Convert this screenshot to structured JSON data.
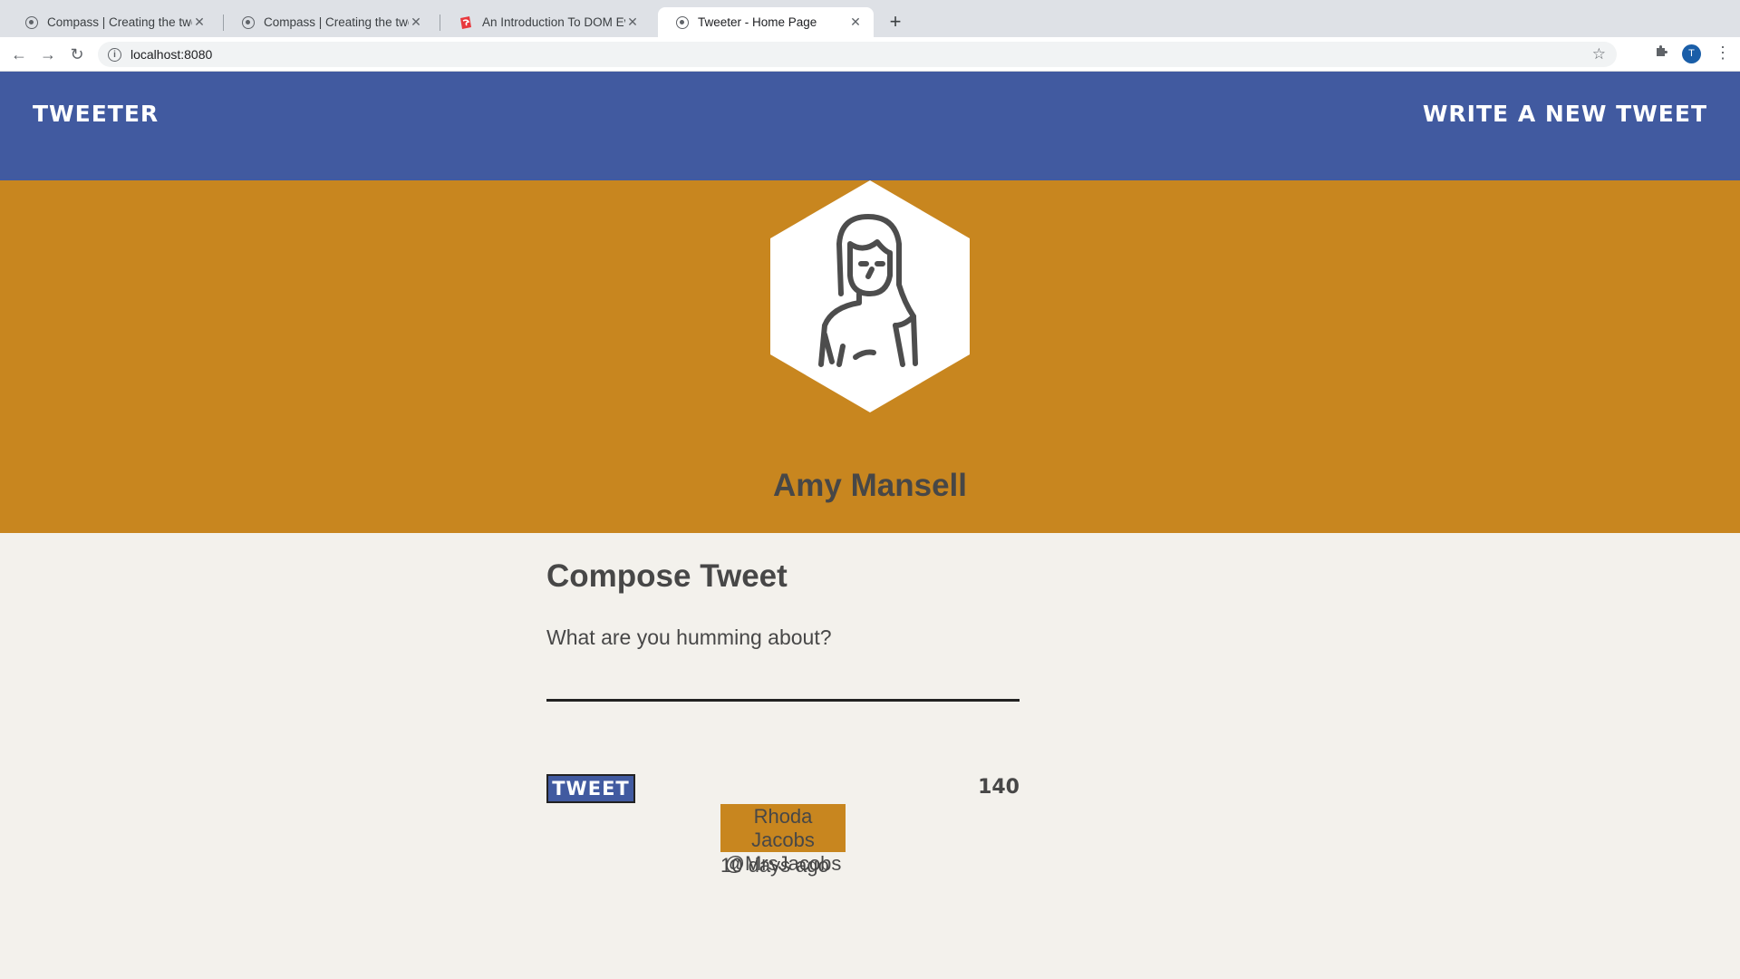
{
  "browser": {
    "tabs": [
      {
        "title": "Compass | Creating the tweets",
        "icon": "compass-icon",
        "active": false
      },
      {
        "title": "Compass | Creating the tweets",
        "icon": "compass-icon",
        "active": false
      },
      {
        "title": "An Introduction To DOM Events",
        "icon": "smashing-icon",
        "active": false
      },
      {
        "title": "Tweeter - Home Page",
        "icon": "globe-icon",
        "active": true
      }
    ],
    "url": "localhost:8080",
    "profile_initial": "T"
  },
  "nav": {
    "brand": "TWEETER",
    "write_link": "WRITE A NEW TWEET",
    "color": "#415aa0"
  },
  "profile": {
    "name": "Amy Mansell",
    "banner_color": "#c8861f"
  },
  "compose": {
    "title": "Compose Tweet",
    "placeholder": "What are you humming about?",
    "button_label": "TWEET",
    "counter": "140"
  },
  "tweet": {
    "name": "Rhoda Jacobs",
    "handle": "@MrsJacobs",
    "time": "10 days ago"
  }
}
